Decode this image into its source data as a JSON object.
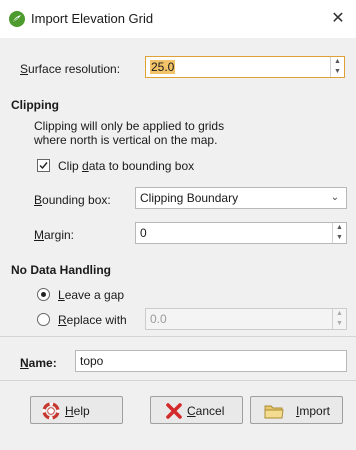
{
  "window": {
    "title": "Import Elevation Grid",
    "close_glyph": "✕",
    "app_icon": "leapfrog-app-icon"
  },
  "surface_resolution": {
    "label": "Surface resolution:",
    "value": "25.0"
  },
  "clipping": {
    "heading": "Clipping",
    "note_line1": "Clipping will only be applied to grids",
    "note_line2": "where north is vertical on the map.",
    "clip_checkbox_label": "Clip data to bounding box",
    "clip_checked": true,
    "bounding_box_label": "Bounding box:",
    "bounding_box_value": "Clipping Boundary",
    "margin_label": "Margin:",
    "margin_value": "0"
  },
  "no_data": {
    "heading": "No Data Handling",
    "leave_gap_label": "Leave a gap",
    "leave_gap_selected": true,
    "replace_with_label": "Replace with",
    "replace_with_value": "0.0"
  },
  "name": {
    "label": "Name:",
    "value": "topo"
  },
  "buttons": {
    "help": "Help",
    "cancel": "Cancel",
    "import": "Import"
  },
  "colors": {
    "focus_border": "#e0a235",
    "selection_highlight": "#f3c36a",
    "panel_bg": "#f0f0f0",
    "cancel_icon": "#d42a2a",
    "help_icon": "#c8372d",
    "import_icon": "#e8c86a"
  }
}
